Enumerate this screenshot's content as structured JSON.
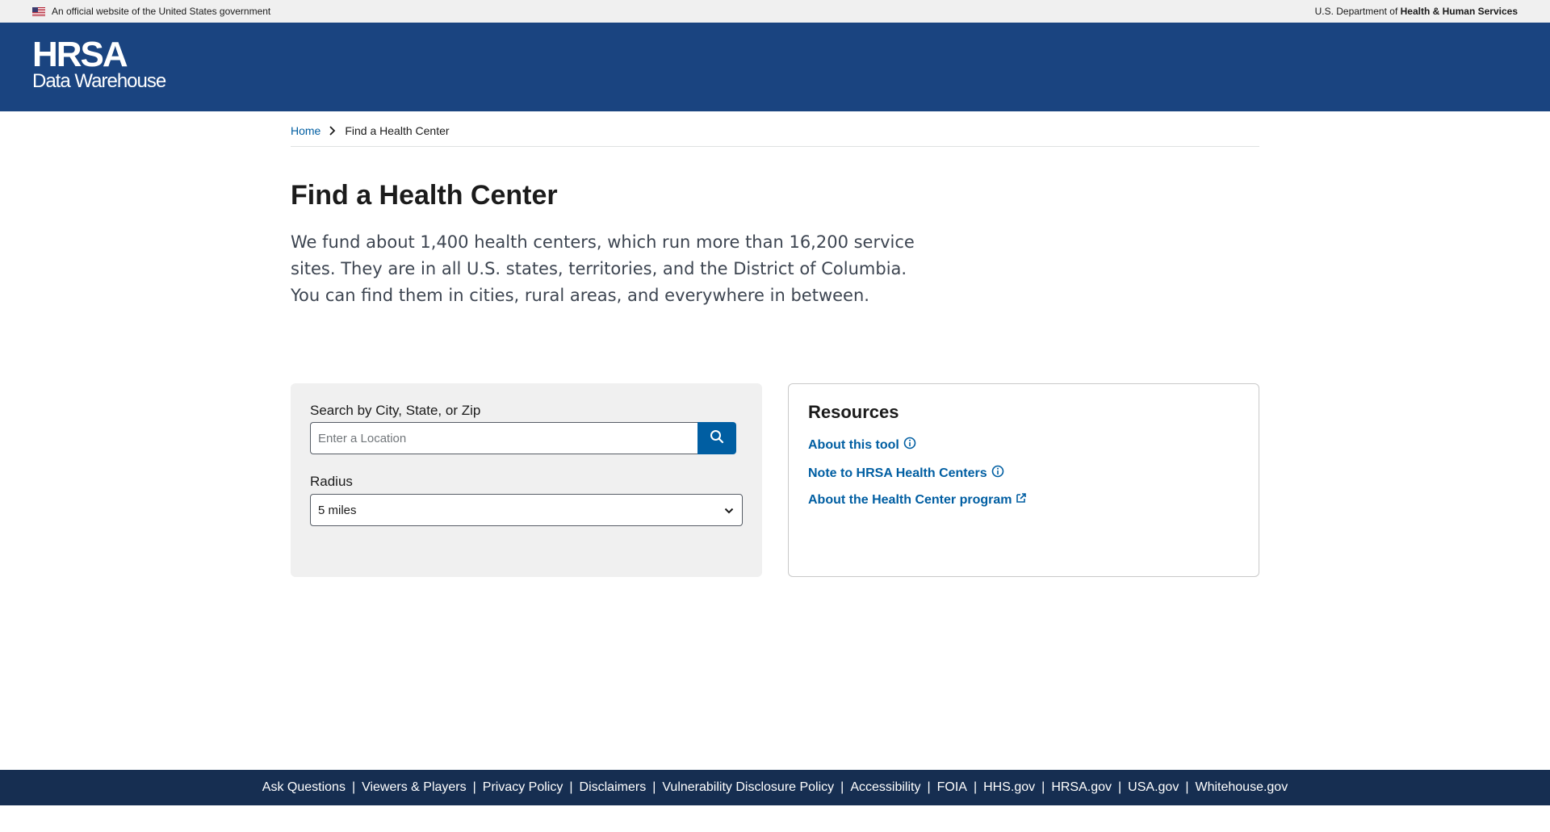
{
  "gov_banner": {
    "official_text": "An official website of the United States government",
    "dept_prefix": "U.S. Department of ",
    "dept_name": "Health & Human Services"
  },
  "header": {
    "logo_main": "HRSA",
    "logo_sub": "Data Warehouse"
  },
  "breadcrumb": {
    "home": "Home",
    "current": "Find a Health Center"
  },
  "page": {
    "title": "Find a Health Center",
    "intro": "We fund about 1,400 health centers, which run more than 16,200 service sites. They are in all U.S. states, territories, and the District of Columbia. You can find them in cities, rural areas, and everywhere in between."
  },
  "search": {
    "label": "Search by City, State, or Zip",
    "placeholder": "Enter a Location",
    "radius_label": "Radius",
    "radius_value": "5 miles"
  },
  "resources": {
    "title": "Resources",
    "links": [
      {
        "label": "About this tool",
        "icon": "info-icon"
      },
      {
        "label": "Note to HRSA Health Centers",
        "icon": "info-icon"
      },
      {
        "label": "About the Health Center program",
        "icon": "external-link-icon"
      }
    ]
  },
  "footer": {
    "links": [
      "Ask Questions",
      "Viewers & Players",
      "Privacy Policy",
      "Disclaimers",
      "Vulnerability Disclosure Policy",
      "Accessibility",
      "FOIA",
      "HHS.gov",
      "HRSA.gov",
      "USA.gov",
      "Whitehouse.gov"
    ],
    "separator": "|"
  },
  "colors": {
    "header_blue": "#1a4480",
    "link_blue": "#005ea2",
    "footer_navy": "#162e51"
  }
}
